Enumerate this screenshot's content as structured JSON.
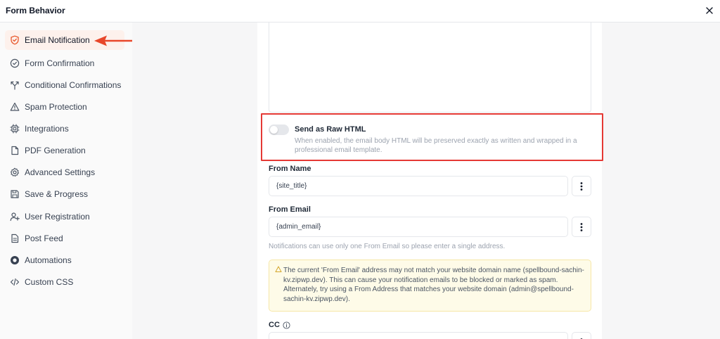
{
  "header": {
    "title": "Form Behavior"
  },
  "sidebar": {
    "items": [
      {
        "label": "Email Notification",
        "icon": "shield-icon",
        "active": true
      },
      {
        "label": "Form Confirmation",
        "icon": "check-circle-icon"
      },
      {
        "label": "Conditional Confirmations",
        "icon": "split-arrows-icon"
      },
      {
        "label": "Spam Protection",
        "icon": "warning-triangle-icon"
      },
      {
        "label": "Integrations",
        "icon": "chip-icon"
      },
      {
        "label": "PDF Generation",
        "icon": "document-icon"
      },
      {
        "label": "Advanced Settings",
        "icon": "gear-icon"
      },
      {
        "label": "Save & Progress",
        "icon": "floppy-disk-icon"
      },
      {
        "label": "User Registration",
        "icon": "user-plus-icon"
      },
      {
        "label": "Post Feed",
        "icon": "document-lines-icon"
      },
      {
        "label": "Automations",
        "icon": "automation-icon"
      },
      {
        "label": "Custom CSS",
        "icon": "code-icon"
      }
    ]
  },
  "main": {
    "raw_html": {
      "title": "Send as Raw HTML",
      "description": "When enabled, the email body HTML will be preserved exactly as written and wrapped in a professional email template.",
      "enabled": false
    },
    "from_name": {
      "label": "From Name",
      "value": "{site_title}"
    },
    "from_email": {
      "label": "From Email",
      "value": "{admin_email}",
      "hint": "Notifications can use only one From Email so please enter a single address."
    },
    "warning": "The current 'From Email' address may not match your website domain name (spellbound-sachin-kv.zipwp.dev). This can cause your notification emails to be blocked or marked as spam. Alternately, try using a From Address that matches your website domain (admin@spellbound-sachin-kv.zipwp.dev).",
    "cc": {
      "label": "CC"
    }
  },
  "colors": {
    "accent": "#e8572a",
    "highlight_border": "#e53935",
    "warning_bg": "#fefbe8"
  }
}
